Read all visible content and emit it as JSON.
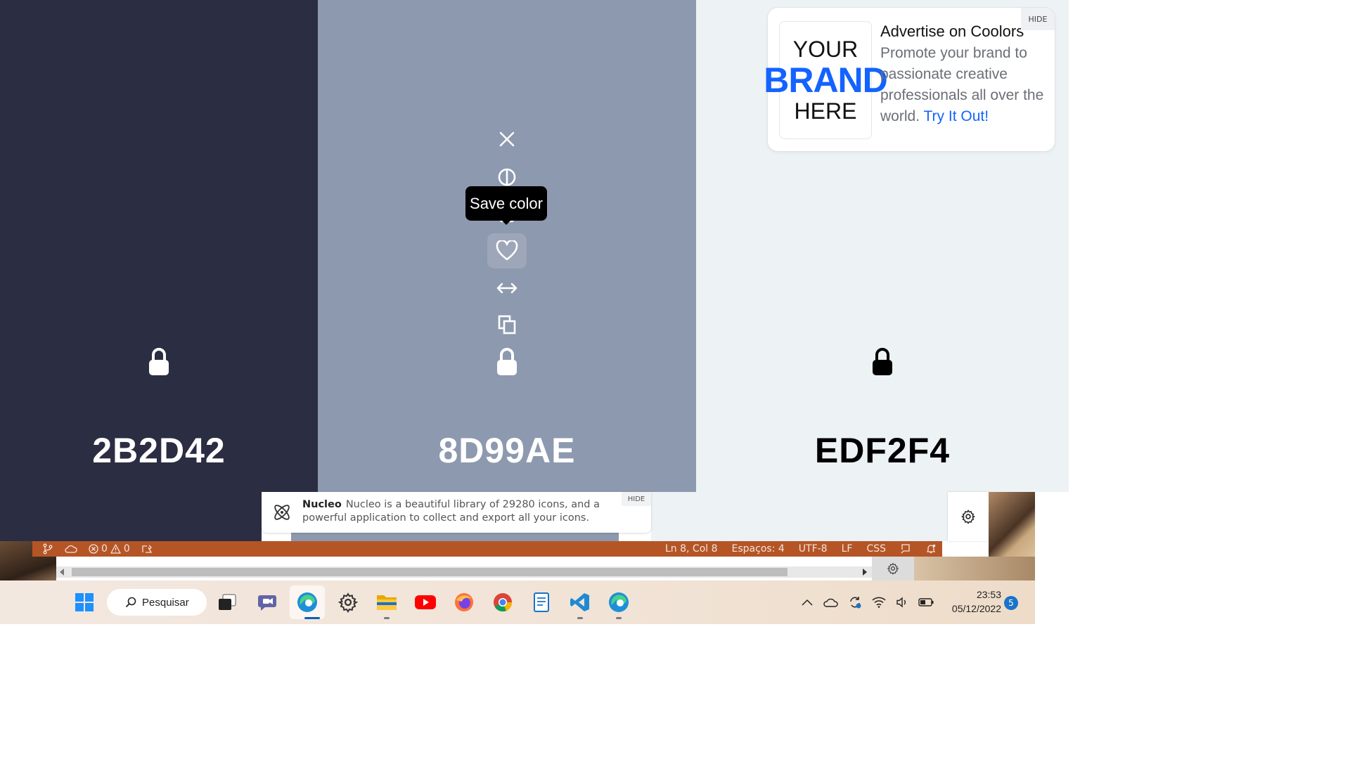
{
  "palette": {
    "colors": [
      {
        "hex": "2B2D42",
        "value": "#2b2d42",
        "text_color": "#ffffff",
        "lock_color": "#ffffff"
      },
      {
        "hex": "8D99AE",
        "value": "#8d99ae",
        "text_color": "#ffffff",
        "lock_color": "#ffffff"
      },
      {
        "hex": "EDF2F4",
        "value": "#edf2f4",
        "text_color": "#000000",
        "lock_color": "#000000"
      }
    ],
    "tools": [
      "close-icon",
      "contrast-icon",
      "drag-icon",
      "heart-icon",
      "arrows-horizontal-icon",
      "copy-icon"
    ],
    "tooltip": "Save color"
  },
  "ad": {
    "logo_line1": "YOUR",
    "logo_line2": "BRAND",
    "logo_line3": "HERE",
    "title": "Advertise on Coolors",
    "text": "Promote your brand to passionate creative professionals all over the world.",
    "cta": "Try It Out!",
    "hide": "HIDE",
    "brand_color": "#1463ff"
  },
  "nucleo": {
    "name": "Nucleo",
    "text": "Nucleo is a beautiful library of 29280 icons, and a powerful application to collect and export all your icons.",
    "hide": "HIDE"
  },
  "statusbar": {
    "errors": "0",
    "warnings": "0",
    "position": "Ln 8, Col 8",
    "indent": "Espaços: 4",
    "encoding": "UTF-8",
    "eol": "LF",
    "language": "CSS",
    "color": "#b55526"
  },
  "taskbar": {
    "search_label": "Pesquisar",
    "apps": [
      "windows-start-icon",
      "task-view-icon",
      "teams-chat-icon",
      "edge-icon",
      "settings-icon",
      "file-explorer-icon",
      "youtube-icon",
      "firefox-icon",
      "chrome-icon",
      "notepad-icon",
      "vscode-icon",
      "edge-icon"
    ],
    "time": "23:53",
    "date": "05/12/2022",
    "notifications": "5"
  }
}
